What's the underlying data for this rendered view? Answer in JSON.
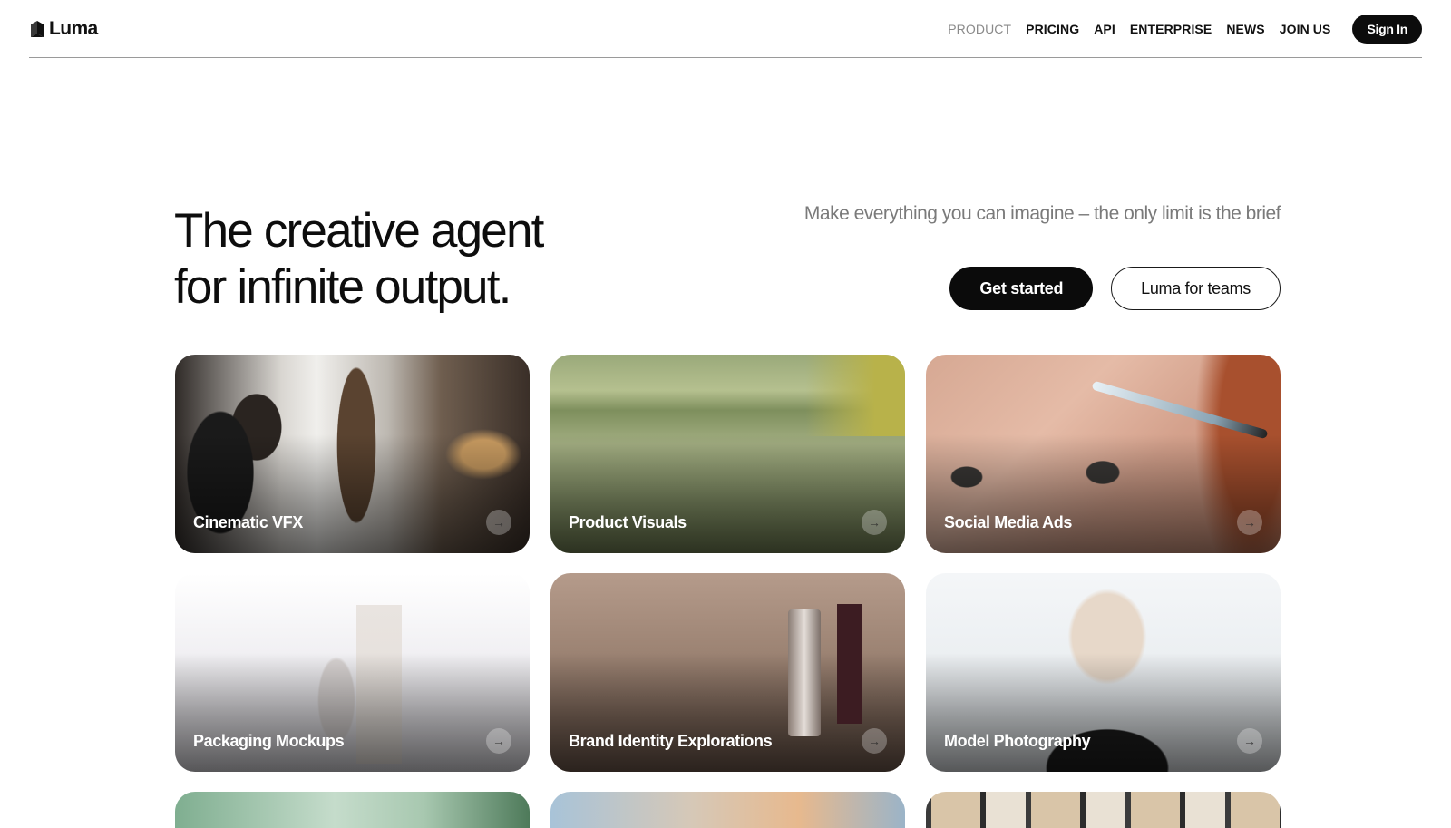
{
  "header": {
    "logo_text": "Luma",
    "nav": [
      {
        "label": "PRODUCT",
        "active": true
      },
      {
        "label": "PRICING"
      },
      {
        "label": "API"
      },
      {
        "label": "ENTERPRISE"
      },
      {
        "label": "NEWS"
      },
      {
        "label": "JOIN US"
      }
    ],
    "sign_in": "Sign In"
  },
  "hero": {
    "title_line1": "The creative agent",
    "title_line2": "for infinite output.",
    "tagline": "Make everything you can imagine – the only limit is the brief",
    "primary_cta": "Get started",
    "secondary_cta": "Luma for teams"
  },
  "cards": [
    {
      "label": "Cinematic VFX",
      "arrow_icon": "arrow-right-icon"
    },
    {
      "label": "Product Visuals",
      "arrow_icon": "arrow-right-icon"
    },
    {
      "label": "Social Media Ads",
      "arrow_icon": "arrow-right-icon"
    },
    {
      "label": "Packaging Mockups",
      "arrow_icon": "arrow-right-icon"
    },
    {
      "label": "Brand Identity Explorations",
      "arrow_icon": "arrow-right-icon"
    },
    {
      "label": "Model Photography",
      "arrow_icon": "arrow-right-icon"
    }
  ],
  "colors": {
    "primary_button": "#0b0b0b",
    "nav_active": "#8a8a8a",
    "tagline": "#7a7a7a",
    "background": "#ffffff"
  }
}
